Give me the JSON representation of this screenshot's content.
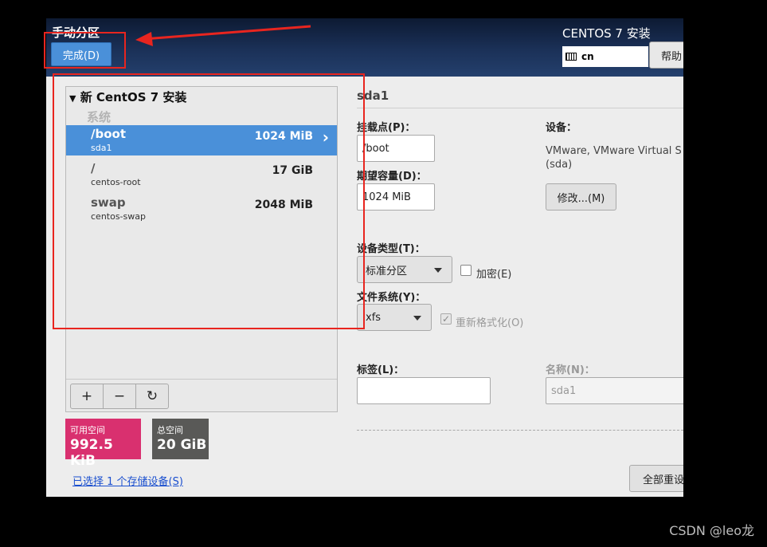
{
  "header": {
    "page_title": "手动分区",
    "done_button": "完成(D)",
    "install_title": "CENTOS 7 安装",
    "keyboard_layout": "cn",
    "help_button": "帮助"
  },
  "left_panel": {
    "group_title": "新 CentOS 7 安装",
    "group_subtitle": "系统",
    "partitions": [
      {
        "mount": "/boot",
        "device": "sda1",
        "size": "1024 MiB",
        "selected": true
      },
      {
        "mount": "/",
        "device": "centos-root",
        "size": "17 GiB",
        "selected": false
      },
      {
        "mount": "swap",
        "device": "centos-swap",
        "size": "2048 MiB",
        "selected": false
      }
    ],
    "toolbar": {
      "add": "+",
      "remove": "−",
      "refresh": "↻"
    }
  },
  "space": {
    "available_label": "可用空间",
    "available_value": "992.5 KiB",
    "available_color": "#d9306f",
    "total_label": "总空间",
    "total_value": "20 GiB",
    "total_color": "#595957"
  },
  "storage_link": "已选择 1 个存储设备(S)",
  "detail": {
    "partition_name": "sda1",
    "mount_point_label": "挂载点(P)：",
    "mount_point_value": "/boot",
    "capacity_label": "期望容量(D)：",
    "capacity_value": "1024 MiB",
    "device_label": "设备：",
    "device_value": "VMware, VMware Virtual S",
    "device_sub": "(sda)",
    "modify_button": "修改...(M)",
    "device_type_label": "设备类型(T)：",
    "device_type_value": "标准分区",
    "encrypt_label": "加密(E)",
    "filesystem_label": "文件系统(Y)：",
    "filesystem_value": "xfs",
    "reformat_label": "重新格式化(O)",
    "tag_label": "标签(L)：",
    "tag_value": "",
    "name_label": "名称(N)：",
    "name_value": "sda1",
    "reset_button": "全部重设"
  },
  "watermark": "CSDN @leo龙",
  "colors": {
    "accent": "#4a90d9",
    "annotation": "#e8251f"
  }
}
